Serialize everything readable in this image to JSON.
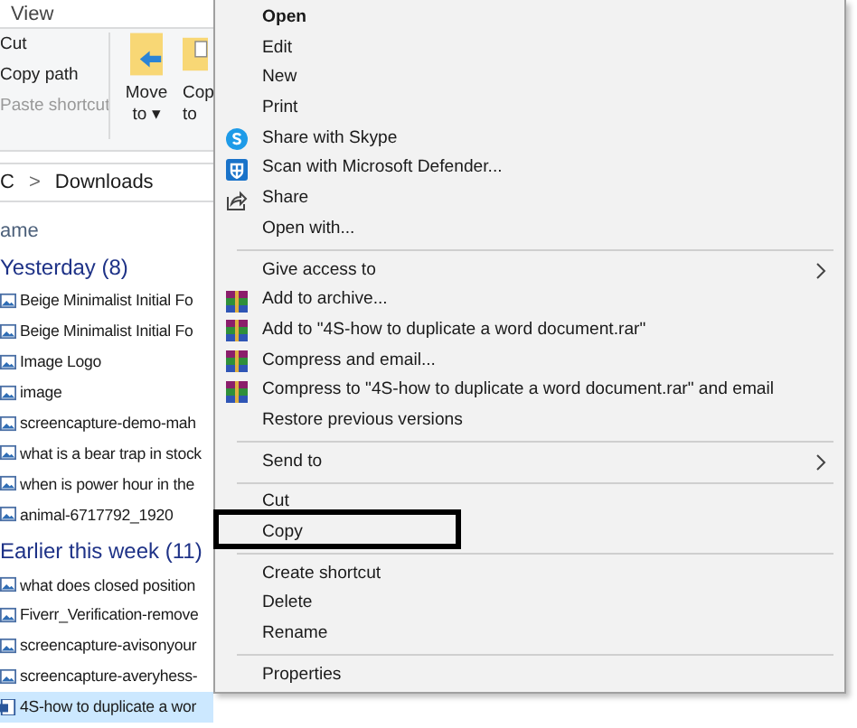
{
  "ribbon": {
    "tab": "View",
    "clipboard_actions": [
      {
        "label": "Cut",
        "disabled": false
      },
      {
        "label": "Copy path",
        "disabled": false
      },
      {
        "label": "Paste shortcut",
        "disabled": true
      }
    ],
    "buttons": [
      {
        "lines": [
          "Move",
          "to ▾"
        ]
      },
      {
        "lines": [
          "Cop",
          "to"
        ]
      }
    ]
  },
  "address_bar": {
    "root": "C",
    "separator": ">",
    "folder": "Downloads"
  },
  "file_list": {
    "column": "ame",
    "groups": [
      {
        "title": "Yesterday (8)",
        "files": [
          {
            "name": "Beige Minimalist Initial Fo",
            "selected": false
          },
          {
            "name": "Beige Minimalist Initial Fo",
            "selected": false
          },
          {
            "name": "Image Logo",
            "selected": false
          },
          {
            "name": "image",
            "selected": false
          },
          {
            "name": "screencapture-demo-mah",
            "selected": false
          },
          {
            "name": "what is a bear trap in stock",
            "selected": false
          },
          {
            "name": "when is power hour in the",
            "selected": false
          },
          {
            "name": "animal-6717792_1920",
            "selected": false
          }
        ]
      },
      {
        "title": "Earlier this week (11)",
        "files": [
          {
            "name": "what does closed position",
            "selected": false
          },
          {
            "name": "Fiverr_Verification-remove",
            "selected": false
          },
          {
            "name": "screencapture-avisonyour",
            "selected": false
          },
          {
            "name": "screencapture-averyhess-",
            "selected": false
          },
          {
            "name": "4S-how to duplicate a wor",
            "selected": true
          }
        ]
      }
    ]
  },
  "context_menu": [
    {
      "kind": "item",
      "label": "Open",
      "bold": true
    },
    {
      "kind": "item",
      "label": "Edit"
    },
    {
      "kind": "item",
      "label": "New"
    },
    {
      "kind": "item",
      "label": "Print"
    },
    {
      "kind": "item",
      "label": "Share with Skype"
    },
    {
      "kind": "item",
      "label": "Scan with Microsoft Defender..."
    },
    {
      "kind": "item",
      "label": "Share"
    },
    {
      "kind": "item",
      "label": "Open with..."
    },
    {
      "kind": "separator"
    },
    {
      "kind": "item",
      "label": "Give access to",
      "submenu": true
    },
    {
      "kind": "item",
      "label": "Add to archive..."
    },
    {
      "kind": "item",
      "label": "Add to \"4S-how to duplicate a word document.rar\""
    },
    {
      "kind": "item",
      "label": "Compress and email..."
    },
    {
      "kind": "item",
      "label": "Compress to \"4S-how to duplicate a word document.rar\" and email"
    },
    {
      "kind": "item",
      "label": "Restore previous versions"
    },
    {
      "kind": "separator"
    },
    {
      "kind": "item",
      "label": "Send to",
      "submenu": true
    },
    {
      "kind": "separator"
    },
    {
      "kind": "item",
      "label": "Cut"
    },
    {
      "kind": "item",
      "label": "Copy",
      "outlined": true
    },
    {
      "kind": "separator"
    },
    {
      "kind": "item",
      "label": "Create shortcut"
    },
    {
      "kind": "item",
      "label": "Delete"
    },
    {
      "kind": "item",
      "label": "Rename"
    },
    {
      "kind": "separator"
    },
    {
      "kind": "item",
      "label": "Properties"
    }
  ]
}
